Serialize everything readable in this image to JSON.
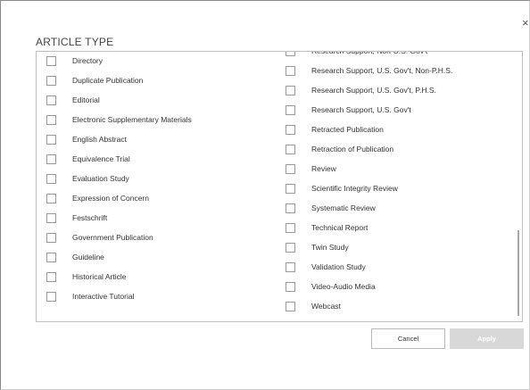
{
  "dialog": {
    "title": "ARTICLE TYPE",
    "close_glyph": "×"
  },
  "left_items": [
    {
      "label": "Directory",
      "checked": false
    },
    {
      "label": "Duplicate Publication",
      "checked": false
    },
    {
      "label": "Editorial",
      "checked": false
    },
    {
      "label": "Electronic Supplementary Materials",
      "checked": false
    },
    {
      "label": "English Abstract",
      "checked": false
    },
    {
      "label": "Equivalence Trial",
      "checked": false
    },
    {
      "label": "Evaluation Study",
      "checked": false
    },
    {
      "label": "Expression of Concern",
      "checked": false
    },
    {
      "label": "Festschrift",
      "checked": false
    },
    {
      "label": "Government Publication",
      "checked": false
    },
    {
      "label": "Guideline",
      "checked": false
    },
    {
      "label": "Historical Article",
      "checked": false
    },
    {
      "label": "Interactive Tutorial",
      "checked": false
    }
  ],
  "right_items": [
    {
      "label": "Research Support, Non-U.S. Gov't",
      "checked": false
    },
    {
      "label": "Research Support, U.S. Gov't, Non-P.H.S.",
      "checked": false
    },
    {
      "label": "Research Support, U.S. Gov't, P.H.S.",
      "checked": false
    },
    {
      "label": "Research Support, U.S. Gov't",
      "checked": false
    },
    {
      "label": "Retracted Publication",
      "checked": false
    },
    {
      "label": "Retraction of Publication",
      "checked": false
    },
    {
      "label": "Review",
      "checked": false
    },
    {
      "label": "Scientific Integrity Review",
      "checked": false
    },
    {
      "label": "Systematic Review",
      "checked": false
    },
    {
      "label": "Technical Report",
      "checked": false
    },
    {
      "label": "Twin Study",
      "checked": false
    },
    {
      "label": "Validation Study",
      "checked": false
    },
    {
      "label": "Video-Audio Media",
      "checked": false
    },
    {
      "label": "Webcast",
      "checked": false
    }
  ],
  "buttons": {
    "cancel_label": "Cancel",
    "apply_label": "Apply"
  }
}
